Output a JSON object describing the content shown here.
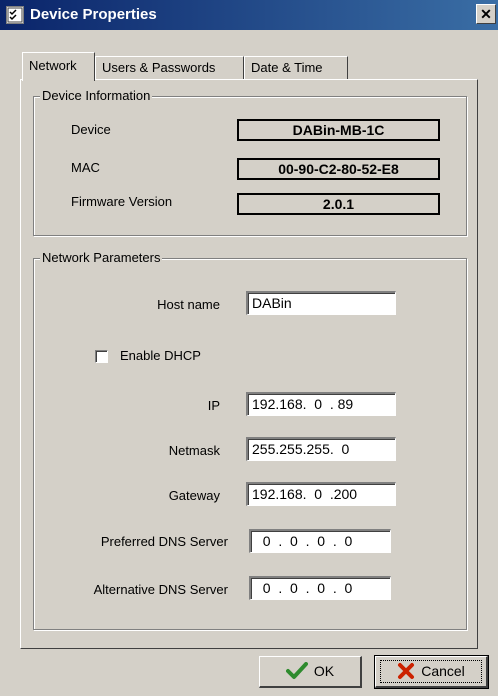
{
  "window": {
    "title": "Device Properties",
    "close_symbol": "✕"
  },
  "tabs": [
    {
      "label": "Network",
      "active": true
    },
    {
      "label": "Users & Passwords",
      "active": false
    },
    {
      "label": "Date & Time",
      "active": false
    }
  ],
  "device_info": {
    "legend": "Device Information",
    "device_label": "Device",
    "device_value": "DABin-MB-1C",
    "mac_label": "MAC",
    "mac_value": "00-90-C2-80-52-E8",
    "firmware_label": "Firmware Version",
    "firmware_value": "2.0.1"
  },
  "network": {
    "legend": "Network Parameters",
    "host_label": "Host name",
    "host_value": "DABin",
    "dhcp_label": "Enable DHCP",
    "dhcp_checked": false,
    "ip_label": "IP",
    "ip_value": "192.168.  0  . 89",
    "netmask_label": "Netmask",
    "netmask_value": "255.255.255.  0",
    "gateway_label": "Gateway",
    "gateway_value": "192.168.  0  .200",
    "dns1_label": "Preferred DNS Server",
    "dns1_value": "  0  .  0  .  0  .  0",
    "dns2_label": "Alternative DNS Server",
    "dns2_value": "  0  .  0  .  0  .  0"
  },
  "buttons": {
    "ok_label": "OK",
    "cancel_label": "Cancel"
  },
  "colors": {
    "title_gradient_start": "#0a246a",
    "title_gradient_end": "#3a6ea5",
    "face": "#d4d0c8",
    "ok_check": "#2e8b2e",
    "cancel_x": "#cc2200"
  },
  "icons": {
    "app": "app-checklist-icon",
    "ok": "checkmark-icon",
    "cancel": "x-icon"
  }
}
